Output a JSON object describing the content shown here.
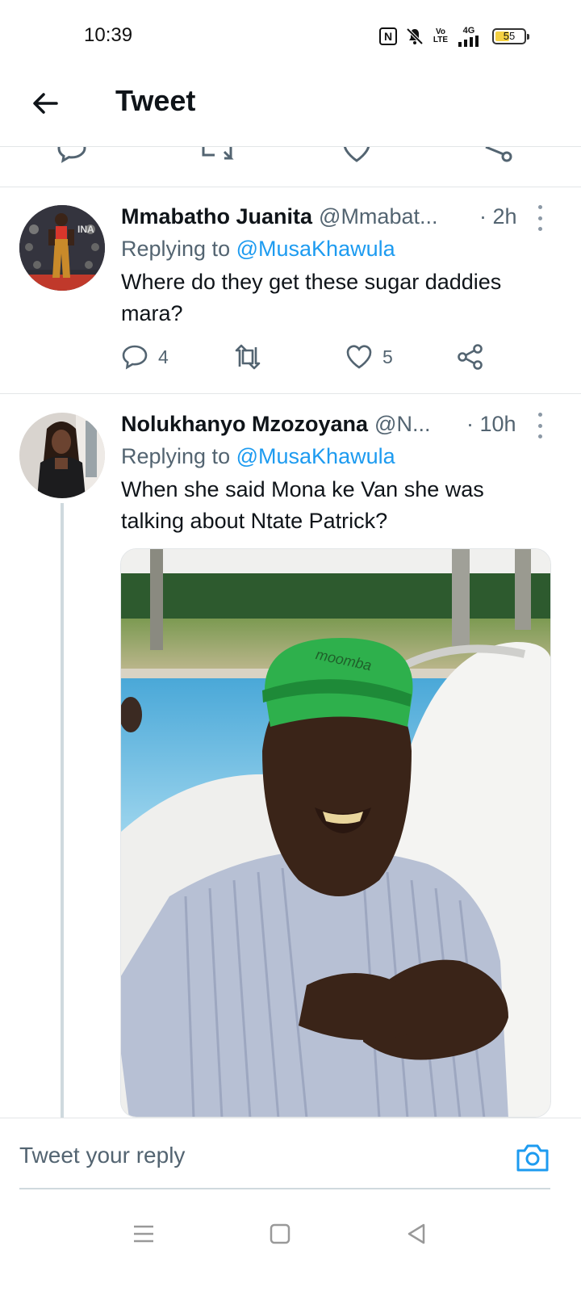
{
  "status_bar": {
    "time": "10:39",
    "network": "4G",
    "volte": "Vo LTE",
    "battery": "55",
    "battery_level": 0.55
  },
  "header": {
    "title": "Tweet"
  },
  "tweets": [
    {
      "display_name": "Mmabatho Juanita",
      "handle": "@Mmabat...",
      "time": "· 2h",
      "replying_prefix": "Replying to",
      "replying_to": "@MusaKhawula",
      "text_line1": "Where do they get these sugar daddies",
      "text_line2": "mara?",
      "replies": "4",
      "likes": "5"
    },
    {
      "display_name": "Nolukhanyo Mzozoyana",
      "handle": "@N...",
      "time": "· 10h",
      "replying_prefix": "Replying to",
      "replying_to": "@MusaKhawula",
      "text_line1": "When she said Mona ke Van she was",
      "text_line2": "talking about Ntate Patrick?",
      "media_cap_text": "moomba"
    }
  ],
  "reply_bar": {
    "placeholder": "Tweet your reply"
  },
  "colors": {
    "accent": "#1d9bf0",
    "secondary_text": "#536471",
    "divider": "#e3e6e8"
  }
}
